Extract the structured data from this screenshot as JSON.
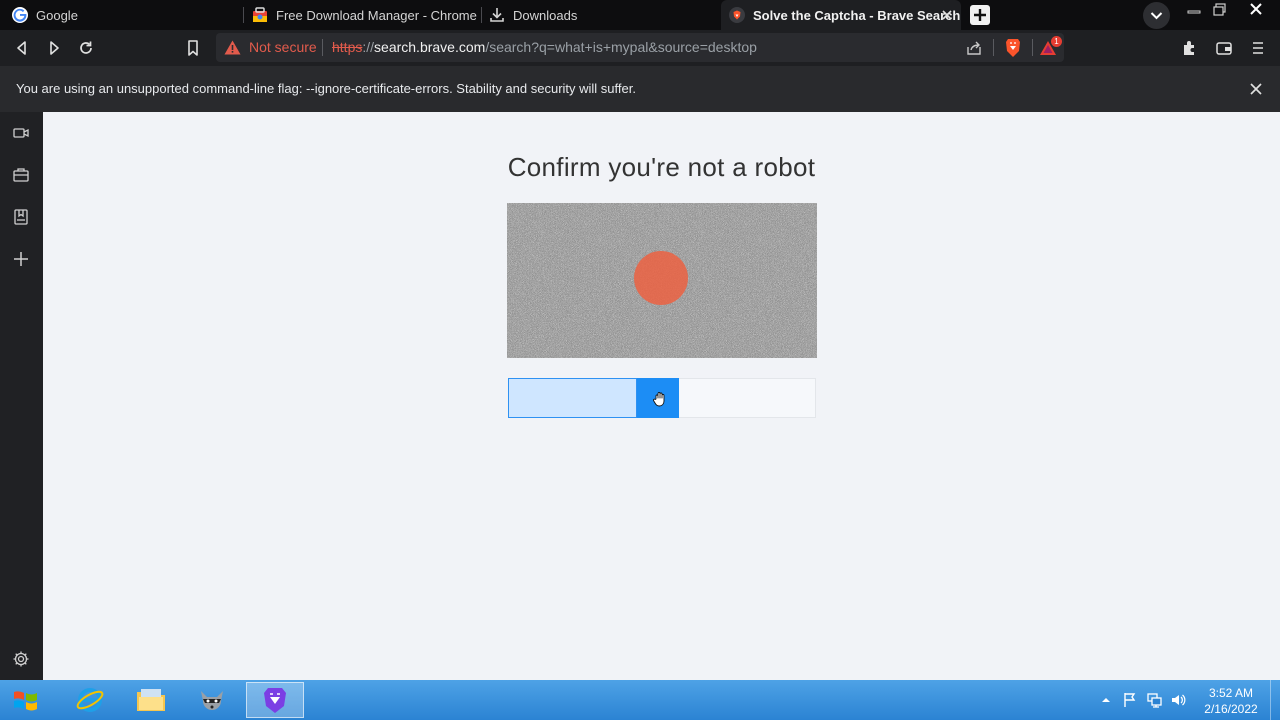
{
  "tabs": [
    {
      "title": "Google",
      "favicon": "google-g-icon",
      "active": false
    },
    {
      "title": "Free Download Manager - Chrome We",
      "favicon": "web-store-icon",
      "active": false
    },
    {
      "title": "Downloads",
      "favicon": "download-icon",
      "active": false
    },
    {
      "title": "Solve the Captcha - Brave Search",
      "favicon": "brave-search-icon",
      "active": true
    }
  ],
  "toolbar": {
    "security_label": "Not secure",
    "url": {
      "scheme": "https",
      "separator": "://",
      "host": "search.brave.com",
      "path": "/search?q=what+is+mypal&source=desktop"
    },
    "rewards_badge": "1"
  },
  "infobar": {
    "message": "You are using an unsupported command-line flag: --ignore-certificate-errors. Stability and security will suffer."
  },
  "page": {
    "heading": "Confirm you're not a robot",
    "slider_progress_percent": 42
  },
  "taskbar": {
    "time": "3:52 AM",
    "date": "2/16/2022"
  },
  "colors": {
    "slider_accent": "#1c8df5",
    "not_secure": "#e25b4c",
    "taskbar": "#2b83d3"
  }
}
